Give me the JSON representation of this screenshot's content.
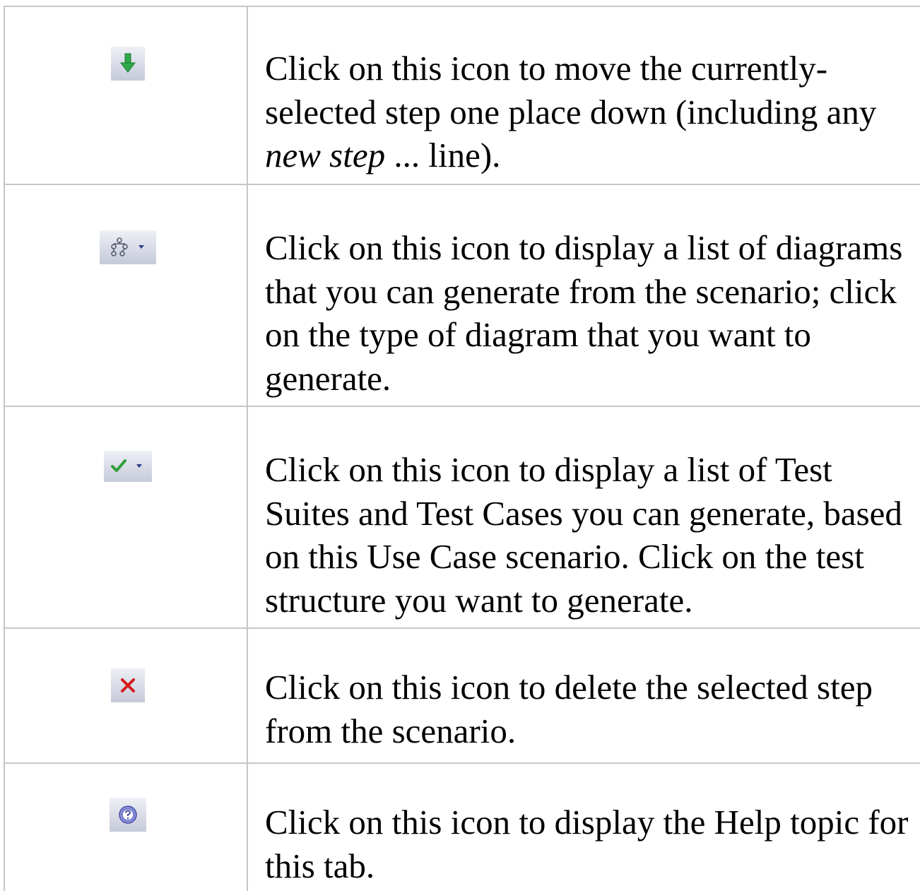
{
  "rows": [
    {
      "icon": "move-down-arrow-icon",
      "text_before": "Click on this icon to move the currently-selected step one place down (including any ",
      "text_italic": "new step",
      "text_after": " ... line)."
    },
    {
      "icon": "diagram-dropdown-icon",
      "text": "Click on this icon to display a list of diagrams that you can generate from the scenario; click on the type of diagram that you want to generate."
    },
    {
      "icon": "test-checkmark-dropdown-icon",
      "text": "Click on this icon to display a list of Test Suites and Test Cases you can generate, based on this Use Case scenario. Click on the test structure you want to generate."
    },
    {
      "icon": "delete-x-icon",
      "text": "Click on this icon to delete the selected step from the scenario."
    },
    {
      "icon": "help-icon",
      "text": "Click on this icon to display the Help topic for this tab."
    }
  ],
  "colors": {
    "border": "#c6c6c6",
    "arrow": "#2ea84a",
    "check": "#2e9e3a",
    "delete": "#d4191a",
    "help": "#6a72c8"
  }
}
